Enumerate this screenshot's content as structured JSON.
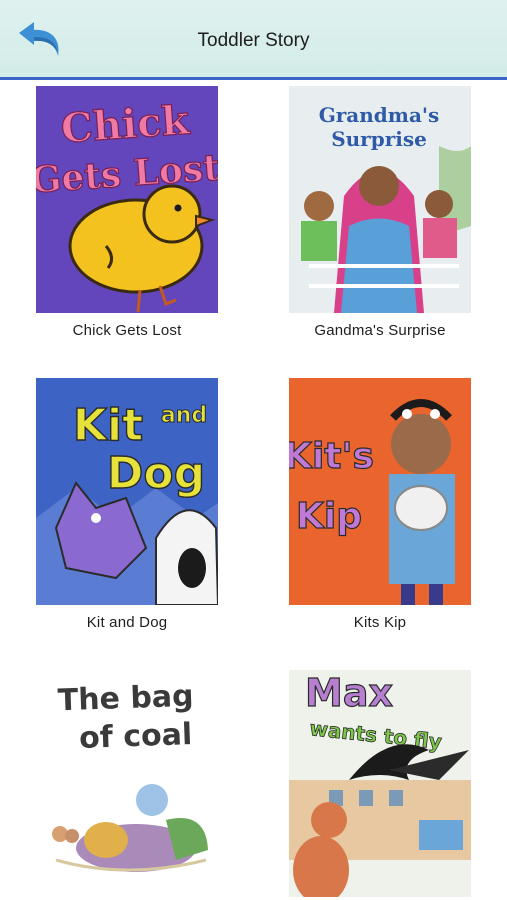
{
  "header": {
    "title": "Toddler Story",
    "back_icon": "undo-arrow-icon",
    "accent": "#3c63c8"
  },
  "books": [
    {
      "caption": "Chick Gets Lost",
      "cover_title": [
        "Chick",
        "Gets Lost"
      ]
    },
    {
      "caption": "Gandma's Surprise",
      "cover_title": [
        "Grandma's",
        "Surprise"
      ]
    },
    {
      "caption": "Kit and Dog",
      "cover_title": [
        "Kit",
        "and",
        "Dog"
      ]
    },
    {
      "caption": "Kits Kip",
      "cover_title": [
        "Kit's",
        "Kip"
      ]
    },
    {
      "caption": "",
      "cover_title": [
        "The bag",
        "of coal"
      ]
    },
    {
      "caption": "",
      "cover_title": [
        "Max",
        "wants to fly"
      ]
    }
  ]
}
